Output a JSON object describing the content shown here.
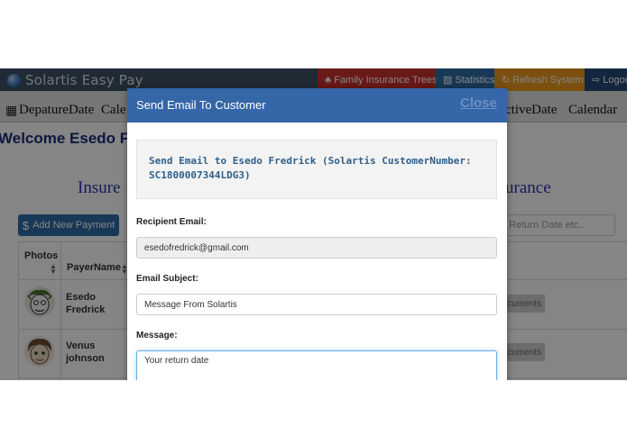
{
  "app": {
    "brand": "Solartis Easy Pay"
  },
  "nav": {
    "family": "Family Insurance Trees",
    "statistics": "Statistics",
    "refresh": "Refresh System",
    "logout": "Logout"
  },
  "filters": {
    "departure": "DepatureDate",
    "calendar_left": "Cale",
    "active": "ctiveDate",
    "calendar_right": "Calendar"
  },
  "page": {
    "welcome": "Welcome Esedo F",
    "section_left": "Insure",
    "section_right": "urance",
    "add_payment": "Add New Payment",
    "search_placeholder": "te, Return Date etc.."
  },
  "table": {
    "headers": {
      "photos": "Photos",
      "payer_name": "PayerName"
    },
    "rows": [
      {
        "first": "Esedo",
        "last": "Fredrick",
        "action": "ocuments"
      },
      {
        "first": "Venus",
        "last": "johnson",
        "action": "ocuments"
      }
    ]
  },
  "modal": {
    "title": "Send Email To Customer",
    "close": "Close",
    "info": "Send Email to Esedo Fredrick (Solartis CustomerNumber: SC1800007344LDG3)",
    "recipient_label": "Recipient Email:",
    "recipient_value": "esedofredrick@gmail.com",
    "subject_label": "Email Subject:",
    "subject_value": "Message From Solartis",
    "message_label": "Message:",
    "message_value": "Your return date"
  },
  "colors": {
    "topbar": "#3f5266",
    "family_button": "#c9302c",
    "statistics_button": "#2f6ca8",
    "refresh_button": "#ec971f",
    "logout_button": "#254a78",
    "modal_header": "#3566a8",
    "welcome_text": "#1a2c7a"
  },
  "icons": {
    "brand": "globe-icon",
    "family": "tree-icon",
    "statistics": "bar-chart-icon",
    "refresh": "refresh-icon",
    "logout": "sign-out-icon",
    "filter": "calendar-icon",
    "add_payment": "dollar-icon",
    "sort": "sort-icon"
  }
}
